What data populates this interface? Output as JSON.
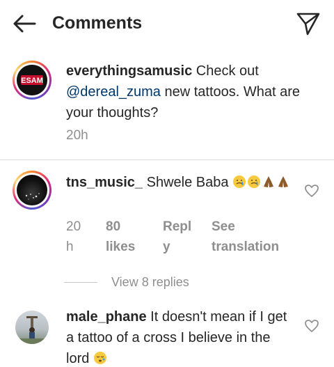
{
  "header": {
    "title": "Comments"
  },
  "caption": {
    "username": "everythingsamusic",
    "text_before": "Check out",
    "mention": "@dereal_zuma",
    "text_after": "new tattoos. What are your thoughts?",
    "time": "20h",
    "avatar_text": "ESAM"
  },
  "comments": [
    {
      "username": "tns_music_",
      "text": "Shwele Baba",
      "emojis": [
        "crying-face",
        "crying-face",
        "folded-hands",
        "folded-hands"
      ],
      "time_part1": "20",
      "time_part2": "h",
      "likes_part1": "80",
      "likes_part2": "likes",
      "reply_part1": "Repl",
      "reply_part2": "y",
      "see_part1": "See",
      "see_part2": "translation",
      "view_replies": "View 8 replies"
    },
    {
      "username": "male_phane",
      "text": "It doesn't mean if I get a tattoo of a cross I believe in the lord",
      "emojis": [
        "sleepy-face"
      ]
    }
  ],
  "colors": {
    "text": "#262626",
    "secondary": "#8e8e8e",
    "link": "#00376b"
  }
}
